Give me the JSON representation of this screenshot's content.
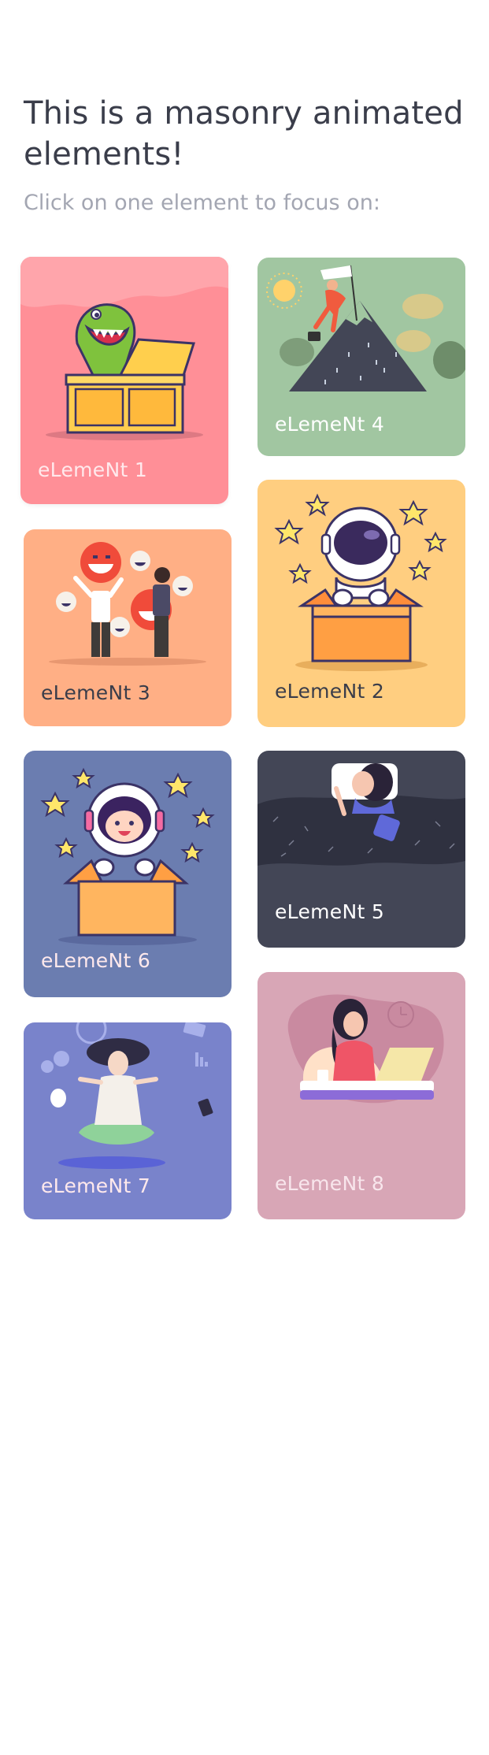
{
  "header": {
    "title": "This is a masonry animated elements!",
    "subtitle": "Click on one element to focus on:"
  },
  "cards": [
    {
      "label": "eLemeNt 1",
      "bg": "#ff8f97",
      "illustration": "dinosaur-in-box"
    },
    {
      "label": "eLemeNt 2",
      "bg": "#ffce80",
      "illustration": "astronaut-in-box"
    },
    {
      "label": "eLemeNt 3",
      "bg": "#ffaf85",
      "illustration": "laughing-people"
    },
    {
      "label": "eLemeNt 4",
      "bg": "#a1c6a1",
      "illustration": "mountain-climber"
    },
    {
      "label": "eLemeNt 5",
      "bg": "#434656",
      "illustration": "sleeping-woman"
    },
    {
      "label": "eLemeNt 6",
      "bg": "#6b7db0",
      "illustration": "girl-astronaut-in-box"
    },
    {
      "label": "eLemeNt 7",
      "bg": "#7983cb",
      "illustration": "meditating-woman"
    },
    {
      "label": "eLemeNt 8",
      "bg": "#d8a6b6",
      "illustration": "woman-at-laptop"
    }
  ]
}
